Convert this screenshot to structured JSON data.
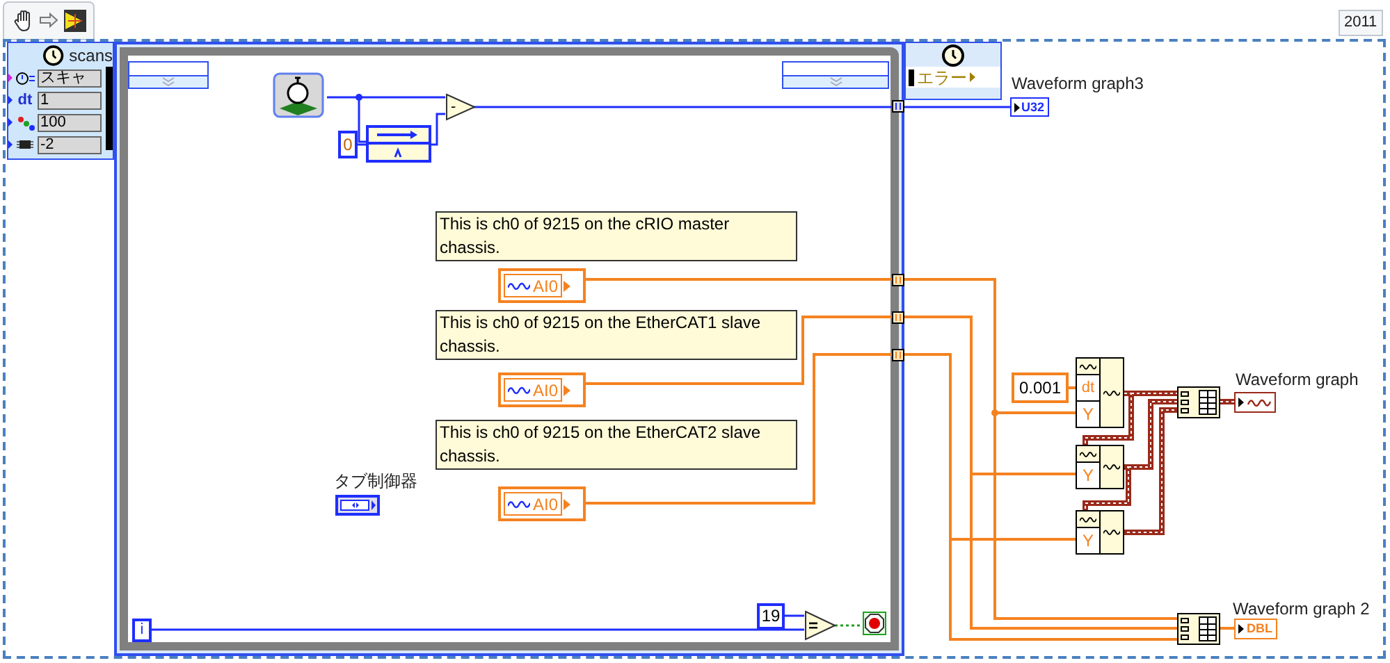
{
  "toolbar": {
    "version": "2011"
  },
  "loop_input": {
    "label": "scans",
    "rows": [
      {
        "kind": "timer",
        "value": "スキャ"
      },
      {
        "kind": "dt",
        "label": "dt",
        "value": "1"
      },
      {
        "kind": "priority",
        "value": "100"
      },
      {
        "kind": "processor",
        "value": "-2"
      }
    ]
  },
  "loop_output": {
    "value": "エラー"
  },
  "start_logic": {
    "constant": "0",
    "operator": "-"
  },
  "indicator_u32": {
    "label": "Waveform graph3",
    "type": "U32"
  },
  "channels": [
    {
      "comment": "This is ch0 of 9215 on the cRIO master chassis.",
      "name": "AI0"
    },
    {
      "comment": "This is ch0 of 9215 on the EtherCAT1 slave chassis.",
      "name": "AI0"
    },
    {
      "comment": "This is ch0 of 9215 on the EtherCAT2 slave chassis.",
      "name": "AI0"
    }
  ],
  "tab_control": {
    "label": "タブ制御器"
  },
  "dt_constant": "0.001",
  "build_nodes": [
    {
      "dt_label": "dt",
      "y_label": "Y"
    },
    {
      "y_label": "Y"
    },
    {
      "y_label": "Y"
    }
  ],
  "graphs": [
    {
      "label": "Waveform graph",
      "kind": "waveform"
    },
    {
      "label": "Waveform graph 2",
      "kind": "numeric",
      "type": "DBL"
    }
  ],
  "stop_condition": {
    "constant": "19",
    "operator": "=",
    "iteration": "i"
  }
}
